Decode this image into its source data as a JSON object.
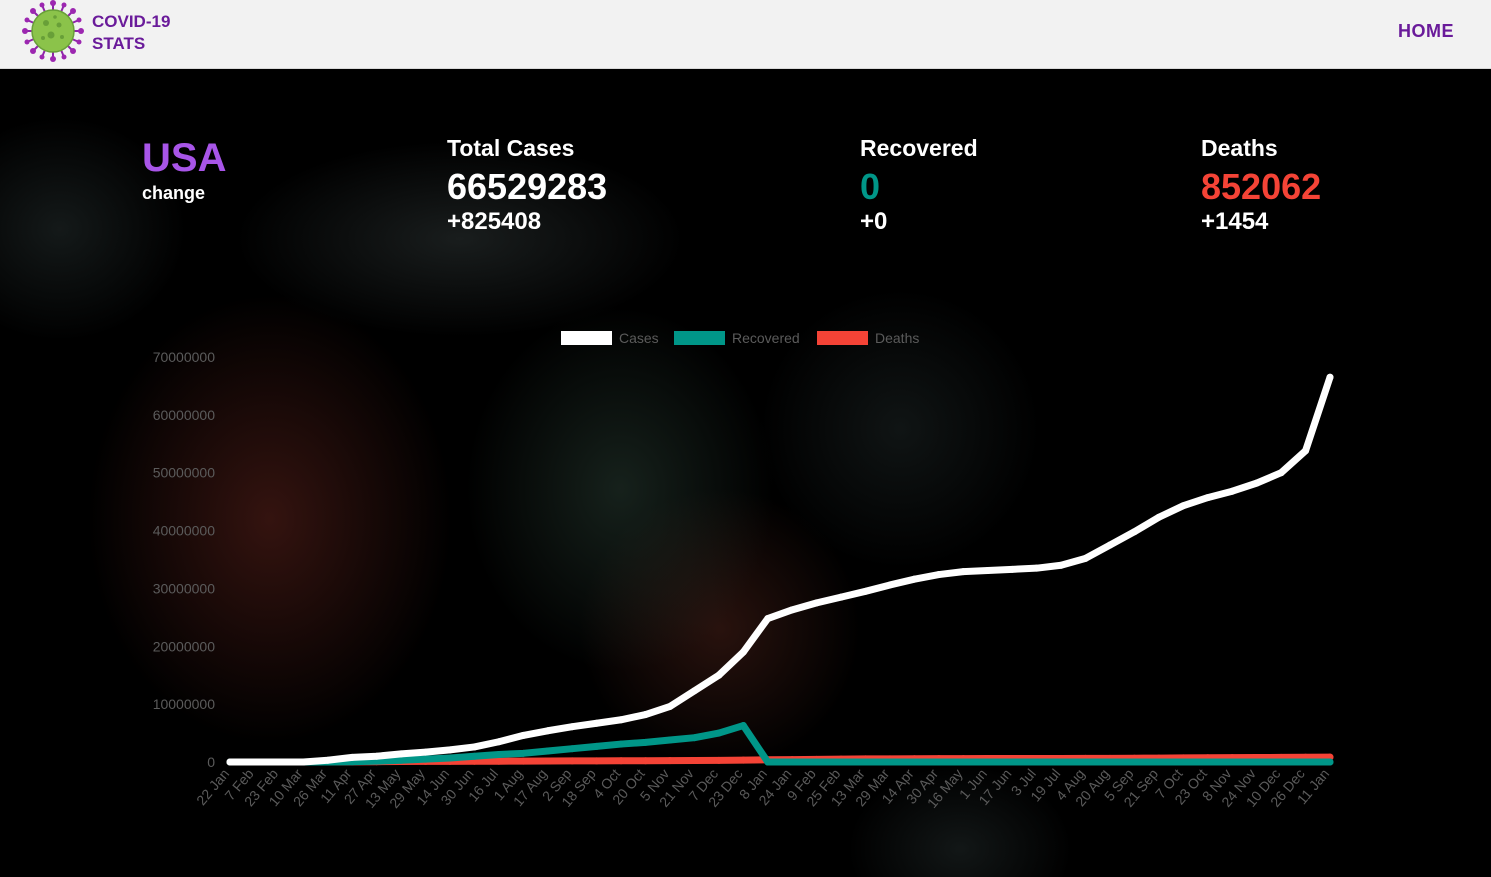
{
  "brand": {
    "line1": "COVID-19",
    "line2": "STATS"
  },
  "nav": {
    "home": "HOME"
  },
  "country": {
    "name": "USA",
    "change_label": "change"
  },
  "stats": {
    "total_cases": {
      "title": "Total Cases",
      "value": "66529283",
      "delta": "+825408"
    },
    "recovered": {
      "title": "Recovered",
      "value": "0",
      "delta": "+0"
    },
    "deaths": {
      "title": "Deaths",
      "value": "852062",
      "delta": "+1454"
    }
  },
  "colors": {
    "brand": "#6a1b9a",
    "country": "#a855e8",
    "cases": "#ffffff",
    "recovered": "#009688",
    "deaths": "#f44336"
  },
  "icons": {
    "logo": "coronavirus-icon"
  },
  "chart_data": {
    "type": "line",
    "legend_position": "top",
    "ylim": [
      0,
      70000000
    ],
    "yticks": [
      0,
      10000000,
      20000000,
      30000000,
      40000000,
      50000000,
      60000000,
      70000000
    ],
    "x_labels": [
      "22 Jan",
      "7 Feb",
      "23 Feb",
      "10 Mar",
      "26 Mar",
      "11 Apr",
      "27 Apr",
      "13 May",
      "29 May",
      "14 Jun",
      "30 Jun",
      "16 Jul",
      "1 Aug",
      "17 Aug",
      "2 Sep",
      "18 Sep",
      "4 Oct",
      "20 Oct",
      "5 Nov",
      "21 Nov",
      "7 Dec",
      "23 Dec",
      "8 Jan",
      "24 Jan",
      "9 Feb",
      "25 Feb",
      "13 Mar",
      "29 Mar",
      "14 Apr",
      "30 Apr",
      "16 May",
      "1 Jun",
      "17 Jun",
      "3 Jul",
      "19 Jul",
      "4 Aug",
      "20 Aug",
      "5 Sep",
      "21 Sep",
      "7 Oct",
      "23 Oct",
      "8 Nov",
      "24 Nov",
      "10 Dec",
      "26 Dec",
      "11 Jan"
    ],
    "series": [
      {
        "name": "Cases",
        "color": "#ffffff",
        "values": [
          0,
          10,
          60,
          1100,
          300000,
          800000,
          1000000,
          1400000,
          1700000,
          2100000,
          2600000,
          3500000,
          4600000,
          5400000,
          6100000,
          6700000,
          7300000,
          8200000,
          9600000,
          12300000,
          15000000,
          19000000,
          24800000,
          26300000,
          27500000,
          28500000,
          29500000,
          30600000,
          31600000,
          32400000,
          32900000,
          33100000,
          33300000,
          33500000,
          34000000,
          35200000,
          37500000,
          39800000,
          42300000,
          44300000,
          45700000,
          46800000,
          48200000,
          50000000,
          53800000,
          66500000
        ]
      },
      {
        "name": "Recovered",
        "color": "#009688",
        "values": [
          0,
          0,
          0,
          10,
          10000,
          40000,
          150000,
          300000,
          500000,
          700000,
          1000000,
          1300000,
          1500000,
          1900000,
          2300000,
          2700000,
          3100000,
          3400000,
          3800000,
          4200000,
          5000000,
          6300000,
          0,
          0,
          0,
          0,
          0,
          0,
          0,
          0,
          0,
          0,
          0,
          0,
          0,
          0,
          0,
          0,
          0,
          0,
          0,
          0,
          0,
          0,
          0,
          0
        ]
      },
      {
        "name": "Deaths",
        "color": "#f44336",
        "values": [
          0,
          0,
          0,
          30,
          1000,
          20000,
          50000,
          80000,
          100000,
          115000,
          125000,
          140000,
          155000,
          170000,
          185000,
          198000,
          210000,
          220000,
          235000,
          250000,
          280000,
          320000,
          380000,
          420000,
          460000,
          500000,
          530000,
          550000,
          565000,
          580000,
          590000,
          595000,
          600000,
          605000,
          610000,
          620000,
          635000,
          650000,
          680000,
          710000,
          730000,
          750000,
          770000,
          790000,
          815000,
          852062
        ]
      }
    ]
  }
}
